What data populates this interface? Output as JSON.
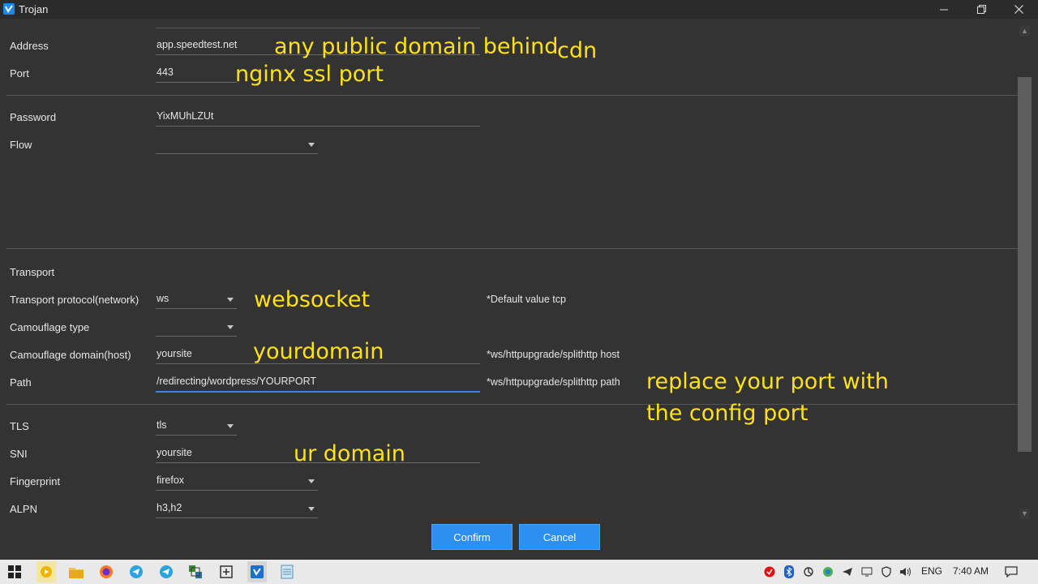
{
  "window": {
    "title": "Trojan"
  },
  "form": {
    "address": {
      "label": "Address",
      "value": "app.speedtest.net"
    },
    "port": {
      "label": "Port",
      "value": "443"
    },
    "password": {
      "label": "Password",
      "value": "YixMUhLZUt"
    },
    "flow": {
      "label": "Flow",
      "value": ""
    },
    "transport_heading": "Transport",
    "network": {
      "label": "Transport protocol(network)",
      "value": "ws",
      "hint": "*Default value tcp"
    },
    "camouflage_type": {
      "label": "Camouflage type",
      "value": ""
    },
    "host": {
      "label": "Camouflage domain(host)",
      "value": "yoursite",
      "hint": "*ws/httpupgrade/splithttp host"
    },
    "path": {
      "label": "Path",
      "value": "/redirecting/wordpress/YOURPORT",
      "hint": "*ws/httpupgrade/splithttp path"
    },
    "tls": {
      "label": "TLS",
      "value": "tls"
    },
    "sni": {
      "label": "SNI",
      "value": "yoursite"
    },
    "fingerprint": {
      "label": "Fingerprint",
      "value": "firefox"
    },
    "alpn": {
      "label": "ALPN",
      "value": "h3,h2"
    }
  },
  "annotations": {
    "address_note": "any public domain behind",
    "address_note2": "cdn",
    "port_note": "nginx ssl port",
    "network_note": "websocket",
    "host_note": "yourdomain",
    "path_note1": "replace your port with",
    "path_note2": "the config port",
    "sni_note": "ur domain"
  },
  "buttons": {
    "confirm": "Confirm",
    "cancel": "Cancel"
  },
  "taskbar": {
    "language": "ENG",
    "time": "7:40 AM"
  },
  "colors": {
    "accent": "#2d8ff0",
    "annotation": "#ffe11a",
    "background": "#333333"
  }
}
